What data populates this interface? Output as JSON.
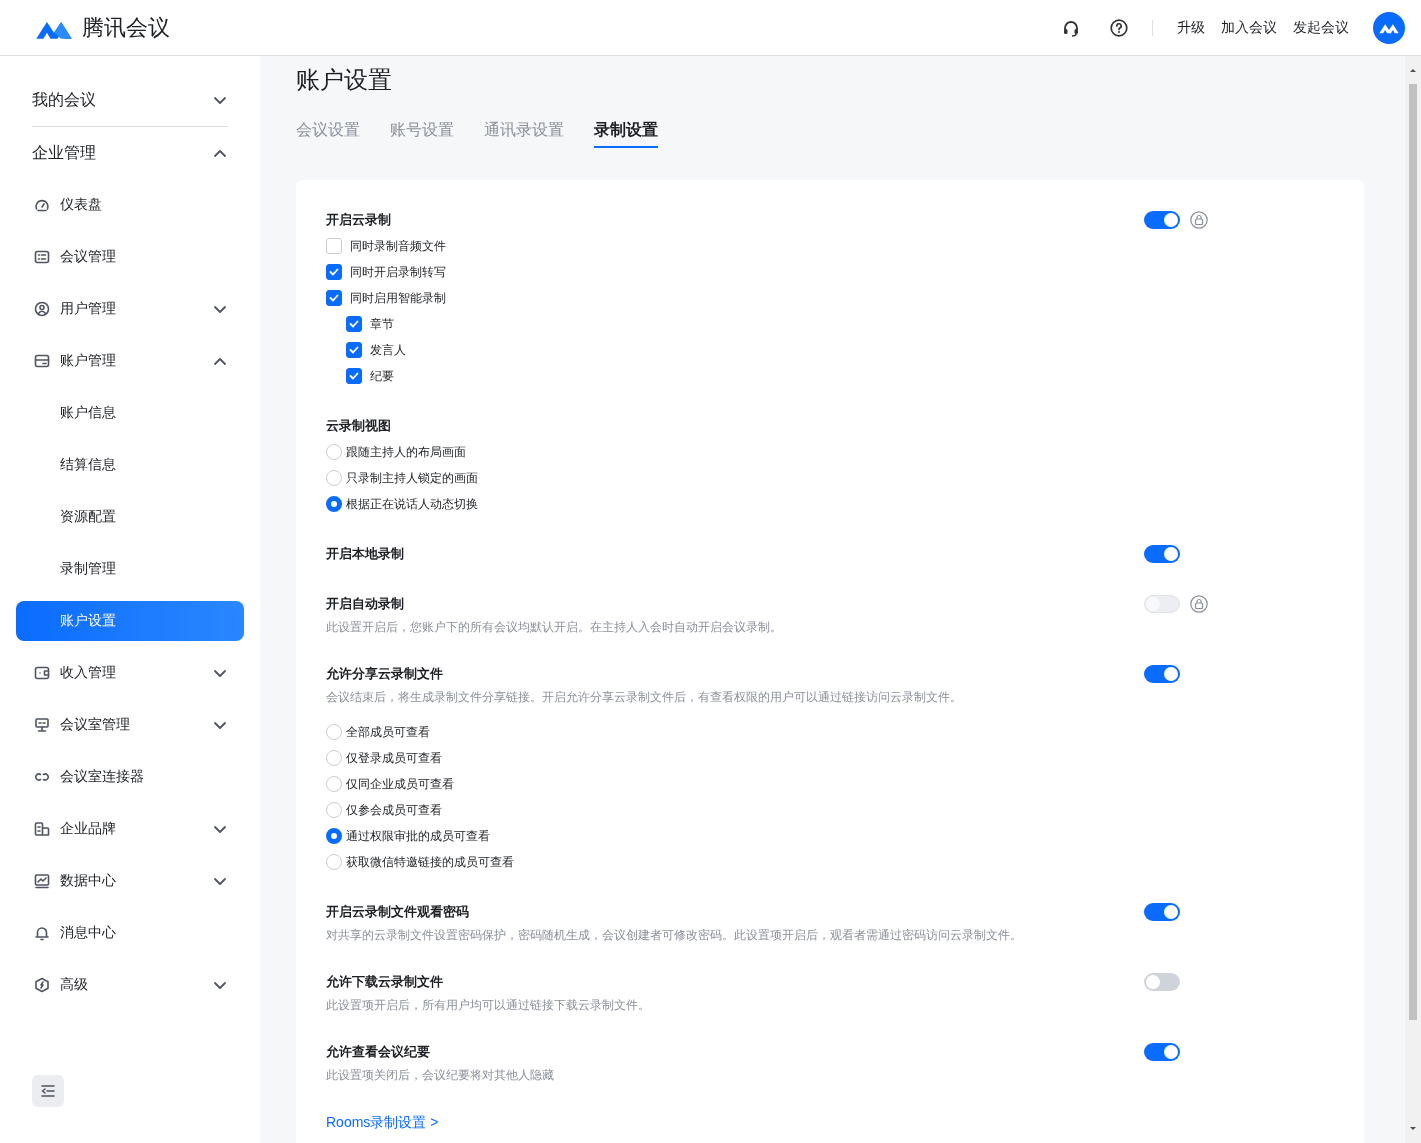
{
  "header": {
    "product_name": "腾讯会议",
    "links": [
      "升级",
      "加入会议",
      "发起会议"
    ]
  },
  "sidebar": [
    {
      "label": "我的会议",
      "expanded": false
    },
    {
      "label": "企业管理",
      "expanded": true,
      "children": [
        {
          "label": "仪表盘",
          "selected": false
        },
        {
          "label": "会议管理",
          "selected": false
        },
        {
          "label": "用户管理",
          "expanded": false,
          "selected": false
        },
        {
          "label": "账户管理",
          "expanded": true,
          "children": [
            {
              "label": "账户信息",
              "selected": false
            },
            {
              "label": "结算信息",
              "selected": false
            },
            {
              "label": "资源配置",
              "selected": false
            },
            {
              "label": "录制管理",
              "selected": false
            },
            {
              "label": "账户设置",
              "selected": true
            }
          ]
        },
        {
          "label": "收入管理",
          "expanded": false,
          "selected": false
        },
        {
          "label": "会议室管理",
          "expanded": false,
          "selected": false
        },
        {
          "label": "会议室连接器",
          "selected": false
        },
        {
          "label": "企业品牌",
          "expanded": false,
          "selected": false
        },
        {
          "label": "数据中心",
          "expanded": false,
          "selected": false
        },
        {
          "label": "消息中心",
          "selected": false
        },
        {
          "label": "高级",
          "expanded": false,
          "selected": false
        }
      ]
    }
  ],
  "page_title": "账户设置",
  "tabs": [
    {
      "label": "会议设置",
      "selected": false
    },
    {
      "label": "账号设置",
      "selected": false
    },
    {
      "label": "通讯录设置",
      "selected": false
    },
    {
      "label": "录制设置",
      "selected": true
    }
  ],
  "settings": [
    {
      "kind": "toggle",
      "title": "开启云录制",
      "on": true,
      "disabled": false,
      "locked": true,
      "checks": [
        {
          "label": "同时录制音频文件",
          "checked": false
        },
        {
          "label": "同时开启录制转写",
          "checked": true
        },
        {
          "label": "同时启用智能录制",
          "checked": true,
          "children": [
            {
              "label": "章节",
              "checked": true
            },
            {
              "label": "发言人",
              "checked": true
            },
            {
              "label": "纪要",
              "checked": true
            }
          ]
        }
      ]
    },
    {
      "kind": "choice",
      "title": "云录制视图",
      "options": [
        {
          "label": "跟随主持人的布局画面",
          "selected": false
        },
        {
          "label": "只录制主持人锁定的画面",
          "selected": false
        },
        {
          "label": "根据正在说话人动态切换",
          "selected": true
        }
      ]
    },
    {
      "kind": "toggle",
      "title": "开启本地录制",
      "on": true,
      "disabled": false,
      "locked": false
    },
    {
      "kind": "toggle",
      "title": "开启自动录制",
      "on": false,
      "disabled": true,
      "locked": true,
      "description": "此设置开启后，您账户下的所有会议均默认开启。在主持人入会时自动开启会议录制。"
    },
    {
      "kind": "toggle",
      "title": "允许分享云录制文件",
      "on": true,
      "disabled": false,
      "locked": false,
      "description": "会议结束后，将生成录制文件分享链接。开启允许分享云录制文件后，有查看权限的用户可以通过链接访问云录制文件。",
      "options": [
        {
          "label": "全部成员可查看",
          "selected": false
        },
        {
          "label": "仅登录成员可查看",
          "selected": false
        },
        {
          "label": "仅同企业成员可查看",
          "selected": false
        },
        {
          "label": "仅参会成员可查看",
          "selected": false
        },
        {
          "label": "通过权限审批的成员可查看",
          "selected": true
        },
        {
          "label": "获取微信特邀链接的成员可查看",
          "selected": false
        }
      ]
    },
    {
      "kind": "toggle",
      "title": "开启云录制文件观看密码",
      "on": true,
      "disabled": false,
      "locked": false,
      "description": "对共享的云录制文件设置密码保护，密码随机生成，会议创建者可修改密码。此设置项开启后，观看者需通过密码访问云录制文件。"
    },
    {
      "kind": "toggle",
      "title": "允许下载云录制文件",
      "on": false,
      "disabled": false,
      "locked": false,
      "description": "此设置项开启后，所有用户均可以通过链接下载云录制文件。"
    },
    {
      "kind": "toggle",
      "title": "允许查看会议纪要",
      "on": true,
      "disabled": false,
      "locked": false,
      "description": "此设置项关闭后，会议纪要将对其他人隐藏"
    },
    {
      "kind": "link",
      "title": "Rooms录制设置 >"
    }
  ]
}
